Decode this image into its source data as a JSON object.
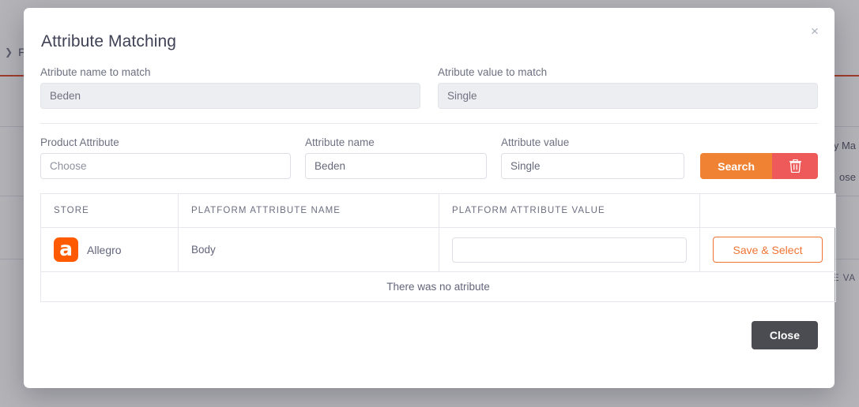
{
  "background": {
    "breadcrumb": {
      "chevron": "chevron-right-icon",
      "label": "Fu"
    },
    "rows": [
      {
        "text": "ry Ma"
      },
      {
        "text": "ose"
      },
      {
        "text": "TE VA"
      }
    ]
  },
  "modal": {
    "title": "Attribute Matching",
    "close_icon": "×",
    "match_fields": {
      "name": {
        "label": "Atribute name to match",
        "value": "Beden"
      },
      "value": {
        "label": "Atribute value to match",
        "value": "Single"
      }
    },
    "search_form": {
      "product_attribute": {
        "label": "Product Attribute",
        "value": "Choose"
      },
      "attribute_name": {
        "label": "Attribute name",
        "value": "Beden"
      },
      "attribute_value": {
        "label": "Attribute value",
        "value": "Single"
      },
      "search_button": "Search",
      "delete_icon": "trash-icon"
    },
    "table": {
      "headers": [
        "STORE",
        "PLATFORM ATTRIBUTE NAME",
        "PLATFORM ATTRIBUTE VALUE",
        ""
      ],
      "rows": [
        {
          "store": "Allegro",
          "store_logo_letter": "a",
          "platform_attribute_name": "Body",
          "platform_attribute_value": "",
          "platform_attribute_value_placeholder": "",
          "action_label": "Save & Select"
        }
      ],
      "empty_message": "There was no atribute"
    },
    "footer": {
      "close_label": "Close"
    }
  },
  "colors": {
    "accent_orange": "#ef8233",
    "danger_red": "#ee5a5a",
    "allegro_orange": "#ff5a00",
    "close_gray": "#4b4b52"
  }
}
